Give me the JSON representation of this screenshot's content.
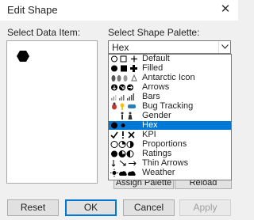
{
  "window": {
    "title": "Edit Shape",
    "close_glyph": "✕"
  },
  "left_panel": {
    "label": "Select Data Item:",
    "selected_shape_icon": "filled-hexagon-icon"
  },
  "right_panel": {
    "label": "Select Shape Palette:",
    "combo_value": "Hex",
    "palettes": [
      {
        "label": "Default",
        "icons": "○ □ +"
      },
      {
        "label": "Filled",
        "icons": "● ■ ✚"
      },
      {
        "label": "Antarctic Icon",
        "icons": "penguin icons"
      },
      {
        "label": "Arrows",
        "icons": "circle arrows"
      },
      {
        "label": "Bars",
        "icons": "signal bars"
      },
      {
        "label": "Bug Tracking",
        "icons": "bug icons"
      },
      {
        "label": "Gender",
        "icons": "person icons"
      },
      {
        "label": "Hex",
        "icons": "● ●"
      },
      {
        "label": "KPI",
        "icons": "✓ ! ✕"
      },
      {
        "label": "Proportions",
        "icons": "pie icons"
      },
      {
        "label": "Ratings",
        "icons": "half circles"
      },
      {
        "label": "Thin Arrows",
        "icons": "↓ ↘ →"
      },
      {
        "label": "Weather",
        "icons": "weather icons"
      }
    ],
    "selected_index": 7
  },
  "hidden_buttons": {
    "assign_palette": "Assign Palette",
    "reload_shapes": "Reload Shapes"
  },
  "footer": {
    "reset": "Reset",
    "ok": "OK",
    "cancel": "Cancel",
    "apply": "Apply"
  },
  "colors": {
    "accent": "#0078d7",
    "dialog_bg": "#f0f0f0"
  }
}
